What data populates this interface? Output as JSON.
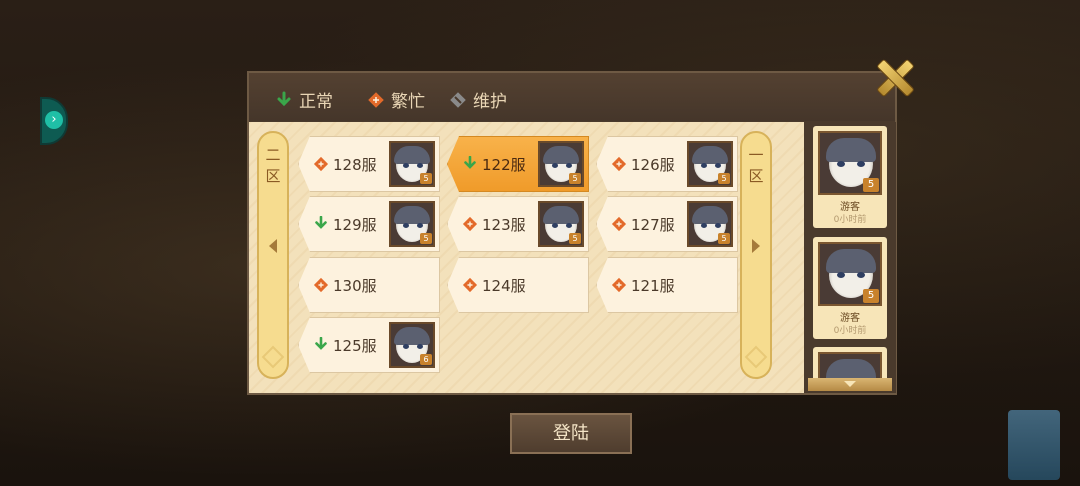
{
  "legend": [
    {
      "label": "正常",
      "icon": "status-normal-icon",
      "color": "#3aa64a"
    },
    {
      "label": "繁忙",
      "icon": "status-busy-icon",
      "color": "#e36a2a"
    },
    {
      "label": "维护",
      "icon": "status-maintenance-icon",
      "color": "#8a8a8a"
    }
  ],
  "zones": {
    "left": {
      "label": "二区"
    },
    "right": {
      "label": "一区"
    }
  },
  "servers": [
    {
      "name": "128服",
      "status": "busy",
      "has_avatar": true,
      "level": "5",
      "selected": false
    },
    {
      "name": "122服",
      "status": "normal",
      "has_avatar": true,
      "level": "5",
      "selected": true
    },
    {
      "name": "126服",
      "status": "busy",
      "has_avatar": true,
      "level": "5",
      "selected": false
    },
    {
      "name": "129服",
      "status": "normal",
      "has_avatar": true,
      "level": "5",
      "selected": false
    },
    {
      "name": "123服",
      "status": "busy",
      "has_avatar": true,
      "level": "5",
      "selected": false
    },
    {
      "name": "127服",
      "status": "busy",
      "has_avatar": true,
      "level": "5",
      "selected": false
    },
    {
      "name": "130服",
      "status": "busy",
      "has_avatar": false,
      "selected": false
    },
    {
      "name": "124服",
      "status": "busy",
      "has_avatar": false,
      "selected": false
    },
    {
      "name": "121服",
      "status": "busy",
      "has_avatar": false,
      "selected": false
    },
    {
      "name": "125服",
      "status": "normal",
      "has_avatar": true,
      "level": "6",
      "selected": false
    }
  ],
  "recent": [
    {
      "name": "游客",
      "time": "0小时前",
      "level": "5"
    },
    {
      "name": "游客",
      "time": "0小时前",
      "level": "5"
    }
  ],
  "login_button": "登陆"
}
